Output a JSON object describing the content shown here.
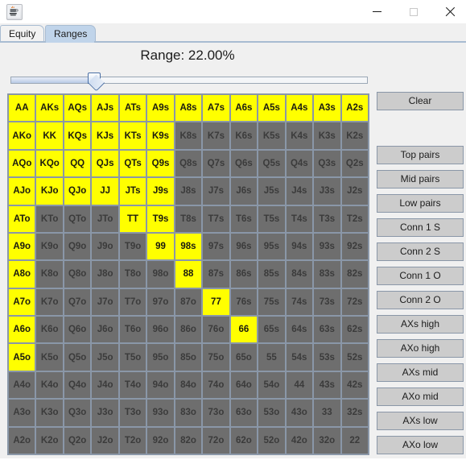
{
  "window": {
    "app_icon": "java-coffee-cup-icon",
    "controls": {
      "minimize": "minimize-icon",
      "maximize": "maximize-icon",
      "close": "close-icon"
    }
  },
  "tabs": [
    {
      "label": "Equity",
      "active": false
    },
    {
      "label": "Ranges",
      "active": true
    }
  ],
  "range": {
    "title": "Range: 22.00%",
    "percent": 22.0,
    "slider": {
      "min": 0,
      "max": 100,
      "value": 22.0
    }
  },
  "colors": {
    "selected": "#ffff00",
    "unselected": "#6e6e6e",
    "grid_line": "#8a97a8",
    "panel": "#f0f0f0",
    "tab_active": "#c0d4ea",
    "button_face": "#cccccc"
  },
  "grid": {
    "rows": 13,
    "cols": 13,
    "cells": [
      [
        {
          "t": "AA",
          "on": true
        },
        {
          "t": "AKs",
          "on": true
        },
        {
          "t": "AQs",
          "on": true
        },
        {
          "t": "AJs",
          "on": true
        },
        {
          "t": "ATs",
          "on": true
        },
        {
          "t": "A9s",
          "on": true
        },
        {
          "t": "A8s",
          "on": true
        },
        {
          "t": "A7s",
          "on": true
        },
        {
          "t": "A6s",
          "on": true
        },
        {
          "t": "A5s",
          "on": true
        },
        {
          "t": "A4s",
          "on": true
        },
        {
          "t": "A3s",
          "on": true
        },
        {
          "t": "A2s",
          "on": true
        }
      ],
      [
        {
          "t": "AKo",
          "on": true
        },
        {
          "t": "KK",
          "on": true
        },
        {
          "t": "KQs",
          "on": true
        },
        {
          "t": "KJs",
          "on": true
        },
        {
          "t": "KTs",
          "on": true
        },
        {
          "t": "K9s",
          "on": true
        },
        {
          "t": "K8s",
          "on": false
        },
        {
          "t": "K7s",
          "on": false
        },
        {
          "t": "K6s",
          "on": false
        },
        {
          "t": "K5s",
          "on": false
        },
        {
          "t": "K4s",
          "on": false
        },
        {
          "t": "K3s",
          "on": false
        },
        {
          "t": "K2s",
          "on": false
        }
      ],
      [
        {
          "t": "AQo",
          "on": true
        },
        {
          "t": "KQo",
          "on": true
        },
        {
          "t": "QQ",
          "on": true
        },
        {
          "t": "QJs",
          "on": true
        },
        {
          "t": "QTs",
          "on": true
        },
        {
          "t": "Q9s",
          "on": true
        },
        {
          "t": "Q8s",
          "on": false
        },
        {
          "t": "Q7s",
          "on": false
        },
        {
          "t": "Q6s",
          "on": false
        },
        {
          "t": "Q5s",
          "on": false
        },
        {
          "t": "Q4s",
          "on": false
        },
        {
          "t": "Q3s",
          "on": false
        },
        {
          "t": "Q2s",
          "on": false
        }
      ],
      [
        {
          "t": "AJo",
          "on": true
        },
        {
          "t": "KJo",
          "on": true
        },
        {
          "t": "QJo",
          "on": true
        },
        {
          "t": "JJ",
          "on": true
        },
        {
          "t": "JTs",
          "on": true
        },
        {
          "t": "J9s",
          "on": true
        },
        {
          "t": "J8s",
          "on": false
        },
        {
          "t": "J7s",
          "on": false
        },
        {
          "t": "J6s",
          "on": false
        },
        {
          "t": "J5s",
          "on": false
        },
        {
          "t": "J4s",
          "on": false
        },
        {
          "t": "J3s",
          "on": false
        },
        {
          "t": "J2s",
          "on": false
        }
      ],
      [
        {
          "t": "ATo",
          "on": true
        },
        {
          "t": "KTo",
          "on": false
        },
        {
          "t": "QTo",
          "on": false
        },
        {
          "t": "JTo",
          "on": false
        },
        {
          "t": "TT",
          "on": true
        },
        {
          "t": "T9s",
          "on": true
        },
        {
          "t": "T8s",
          "on": false
        },
        {
          "t": "T7s",
          "on": false
        },
        {
          "t": "T6s",
          "on": false
        },
        {
          "t": "T5s",
          "on": false
        },
        {
          "t": "T4s",
          "on": false
        },
        {
          "t": "T3s",
          "on": false
        },
        {
          "t": "T2s",
          "on": false
        }
      ],
      [
        {
          "t": "A9o",
          "on": true
        },
        {
          "t": "K9o",
          "on": false
        },
        {
          "t": "Q9o",
          "on": false
        },
        {
          "t": "J9o",
          "on": false
        },
        {
          "t": "T9o",
          "on": false
        },
        {
          "t": "99",
          "on": true
        },
        {
          "t": "98s",
          "on": true
        },
        {
          "t": "97s",
          "on": false
        },
        {
          "t": "96s",
          "on": false
        },
        {
          "t": "95s",
          "on": false
        },
        {
          "t": "94s",
          "on": false
        },
        {
          "t": "93s",
          "on": false
        },
        {
          "t": "92s",
          "on": false
        }
      ],
      [
        {
          "t": "A8o",
          "on": true
        },
        {
          "t": "K8o",
          "on": false
        },
        {
          "t": "Q8o",
          "on": false
        },
        {
          "t": "J8o",
          "on": false
        },
        {
          "t": "T8o",
          "on": false
        },
        {
          "t": "98o",
          "on": false
        },
        {
          "t": "88",
          "on": true
        },
        {
          "t": "87s",
          "on": false
        },
        {
          "t": "86s",
          "on": false
        },
        {
          "t": "85s",
          "on": false
        },
        {
          "t": "84s",
          "on": false
        },
        {
          "t": "83s",
          "on": false
        },
        {
          "t": "82s",
          "on": false
        }
      ],
      [
        {
          "t": "A7o",
          "on": true
        },
        {
          "t": "K7o",
          "on": false
        },
        {
          "t": "Q7o",
          "on": false
        },
        {
          "t": "J7o",
          "on": false
        },
        {
          "t": "T7o",
          "on": false
        },
        {
          "t": "97o",
          "on": false
        },
        {
          "t": "87o",
          "on": false
        },
        {
          "t": "77",
          "on": true
        },
        {
          "t": "76s",
          "on": false
        },
        {
          "t": "75s",
          "on": false
        },
        {
          "t": "74s",
          "on": false
        },
        {
          "t": "73s",
          "on": false
        },
        {
          "t": "72s",
          "on": false
        }
      ],
      [
        {
          "t": "A6o",
          "on": true
        },
        {
          "t": "K6o",
          "on": false
        },
        {
          "t": "Q6o",
          "on": false
        },
        {
          "t": "J6o",
          "on": false
        },
        {
          "t": "T6o",
          "on": false
        },
        {
          "t": "96o",
          "on": false
        },
        {
          "t": "86o",
          "on": false
        },
        {
          "t": "76o",
          "on": false
        },
        {
          "t": "66",
          "on": true
        },
        {
          "t": "65s",
          "on": false
        },
        {
          "t": "64s",
          "on": false
        },
        {
          "t": "63s",
          "on": false
        },
        {
          "t": "62s",
          "on": false
        }
      ],
      [
        {
          "t": "A5o",
          "on": true
        },
        {
          "t": "K5o",
          "on": false
        },
        {
          "t": "Q5o",
          "on": false
        },
        {
          "t": "J5o",
          "on": false
        },
        {
          "t": "T5o",
          "on": false
        },
        {
          "t": "95o",
          "on": false
        },
        {
          "t": "85o",
          "on": false
        },
        {
          "t": "75o",
          "on": false
        },
        {
          "t": "65o",
          "on": false
        },
        {
          "t": "55",
          "on": false
        },
        {
          "t": "54s",
          "on": false
        },
        {
          "t": "53s",
          "on": false
        },
        {
          "t": "52s",
          "on": false
        }
      ],
      [
        {
          "t": "A4o",
          "on": false
        },
        {
          "t": "K4o",
          "on": false
        },
        {
          "t": "Q4o",
          "on": false
        },
        {
          "t": "J4o",
          "on": false
        },
        {
          "t": "T4o",
          "on": false
        },
        {
          "t": "94o",
          "on": false
        },
        {
          "t": "84o",
          "on": false
        },
        {
          "t": "74o",
          "on": false
        },
        {
          "t": "64o",
          "on": false
        },
        {
          "t": "54o",
          "on": false
        },
        {
          "t": "44",
          "on": false
        },
        {
          "t": "43s",
          "on": false
        },
        {
          "t": "42s",
          "on": false
        }
      ],
      [
        {
          "t": "A3o",
          "on": false
        },
        {
          "t": "K3o",
          "on": false
        },
        {
          "t": "Q3o",
          "on": false
        },
        {
          "t": "J3o",
          "on": false
        },
        {
          "t": "T3o",
          "on": false
        },
        {
          "t": "93o",
          "on": false
        },
        {
          "t": "83o",
          "on": false
        },
        {
          "t": "73o",
          "on": false
        },
        {
          "t": "63o",
          "on": false
        },
        {
          "t": "53o",
          "on": false
        },
        {
          "t": "43o",
          "on": false
        },
        {
          "t": "33",
          "on": false
        },
        {
          "t": "32s",
          "on": false
        }
      ],
      [
        {
          "t": "A2o",
          "on": false
        },
        {
          "t": "K2o",
          "on": false
        },
        {
          "t": "Q2o",
          "on": false
        },
        {
          "t": "J2o",
          "on": false
        },
        {
          "t": "T2o",
          "on": false
        },
        {
          "t": "92o",
          "on": false
        },
        {
          "t": "82o",
          "on": false
        },
        {
          "t": "72o",
          "on": false
        },
        {
          "t": "62o",
          "on": false
        },
        {
          "t": "52o",
          "on": false
        },
        {
          "t": "42o",
          "on": false
        },
        {
          "t": "32o",
          "on": false
        },
        {
          "t": "22",
          "on": false
        }
      ]
    ]
  },
  "side_buttons": {
    "clear": "Clear",
    "presets": [
      "Top pairs",
      "Mid pairs",
      "Low pairs",
      "Conn 1 S",
      "Conn 2 S",
      "Conn 1 O",
      "Conn 2 O",
      "AXs high",
      "AXo high",
      "AXs mid",
      "AXo mid",
      "AXs low",
      "AXo low"
    ]
  }
}
